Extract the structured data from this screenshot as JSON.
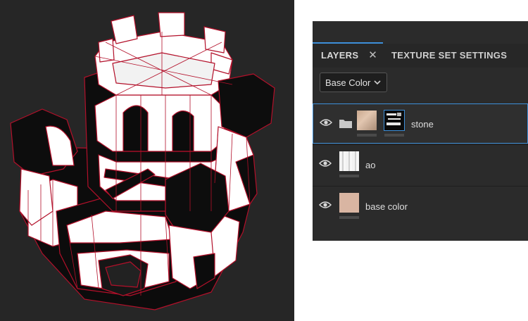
{
  "viewport": {
    "object": "castle"
  },
  "panel": {
    "tabs": [
      {
        "label": "LAYERS",
        "active": true
      },
      {
        "label": "TEXTURE SET SETTINGS",
        "active": false
      }
    ],
    "channel_select": {
      "value": "Base Color"
    },
    "layers": [
      {
        "name": "stone",
        "type": "folder",
        "selected": true,
        "visible": true
      },
      {
        "name": "ao",
        "type": "fill",
        "selected": false,
        "visible": true
      },
      {
        "name": "base color",
        "type": "fill",
        "selected": false,
        "visible": true
      }
    ]
  },
  "colors": {
    "accent": "#3d8fd9",
    "panel_bg": "#2b2b2b",
    "viewport_bg": "#262626",
    "wire": "#c0112a"
  }
}
